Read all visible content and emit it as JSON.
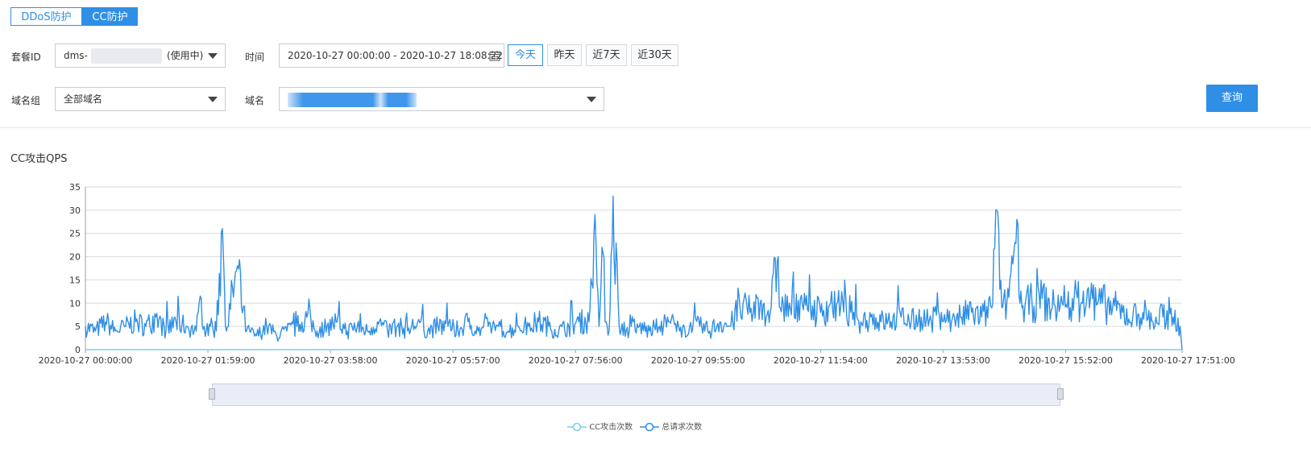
{
  "tabs": [
    {
      "label": "DDoS防护",
      "active": false
    },
    {
      "label": "CC防护",
      "active": true
    }
  ],
  "filters": {
    "package_label": "套餐ID",
    "package_value_prefix": "dms-",
    "package_value_suffix": "(使用中)",
    "time_label": "时间",
    "time_value": "2020-10-27 00:00:00 - 2020-10-27 18:08:22",
    "quick_ranges": [
      "今天",
      "昨天",
      "近7天",
      "近30天"
    ],
    "active_quick_range": "今天",
    "domain_group_label": "域名组",
    "domain_group_value": "全部域名",
    "domain_label": "域名",
    "search_label": "查询"
  },
  "chart_title": "CC攻击QPS",
  "colors": {
    "accent": "#2f8fe6",
    "series_total": "#2f8fe6",
    "series_cc": "#7ecbee",
    "grid": "#d9dce0"
  },
  "chart_data": {
    "type": "line",
    "title": "CC攻击QPS",
    "xlabel": "",
    "ylabel": "",
    "ylim": [
      0,
      35
    ],
    "yticks": [
      0,
      5,
      10,
      15,
      20,
      25,
      30,
      35
    ],
    "x_tick_labels": [
      "2020-10-27 00:00:00",
      "2020-10-27 01:59:00",
      "2020-10-27 03:58:00",
      "2020-10-27 05:57:00",
      "2020-10-27 07:56:00",
      "2020-10-27 09:55:00",
      "2020-10-27 11:54:00",
      "2020-10-27 13:53:00",
      "2020-10-27 15:52:00",
      "2020-10-27 17:51:00"
    ],
    "grid": true,
    "legend_position": "bottom",
    "x_minutes_start": 0,
    "x_minutes_end": 1089,
    "series": [
      {
        "name": "CC攻击次数",
        "style": "flat",
        "x": [
          0,
          1089
        ],
        "y": [
          0,
          0
        ]
      },
      {
        "name": "总请求次数",
        "style": "noisy",
        "x": [
          0,
          10,
          20,
          30,
          40,
          50,
          60,
          70,
          80,
          90,
          100,
          110,
          115,
          118,
          120,
          124,
          130,
          136,
          140,
          150,
          160,
          170,
          180,
          190,
          200,
          210,
          220,
          230,
          240,
          250,
          260,
          270,
          280,
          290,
          300,
          310,
          320,
          330,
          340,
          350,
          360,
          370,
          380,
          390,
          400,
          410,
          420,
          430,
          440,
          450,
          460,
          470,
          480,
          490,
          500,
          505,
          510,
          513,
          517,
          520,
          524,
          530,
          540,
          542,
          544,
          546,
          550,
          560,
          570,
          580,
          590,
          600,
          610,
          620,
          630,
          640,
          650,
          660,
          670,
          680,
          688,
          690,
          700,
          710,
          720,
          730,
          740,
          750,
          760,
          770,
          780,
          790,
          800,
          810,
          820,
          830,
          840,
          850,
          860,
          870,
          880,
          890,
          900,
          905,
          908,
          910,
          915,
          926,
          928,
          930,
          940,
          950,
          960,
          970,
          980,
          990,
          1000,
          1010,
          1020,
          1030,
          1040,
          1050,
          1060,
          1070,
          1080,
          1087,
          1089
        ],
        "y": [
          5,
          4,
          6,
          4,
          5,
          6,
          5,
          7,
          4,
          6,
          5,
          4,
          11,
          5,
          4,
          5,
          4,
          26,
          4,
          17,
          4,
          3,
          5,
          3,
          4,
          5,
          7,
          4,
          5,
          6,
          4,
          5,
          4,
          6,
          4,
          5,
          4,
          6,
          4,
          5,
          5,
          4,
          6,
          4,
          5,
          5,
          4,
          5,
          5,
          6,
          5,
          4,
          5,
          6,
          6,
          25,
          5,
          22,
          6,
          4,
          33,
          5,
          4,
          5,
          6,
          4,
          5,
          4,
          5,
          6,
          4,
          5,
          5,
          4,
          6,
          5,
          9,
          8,
          10,
          8,
          20,
          9,
          9,
          11,
          9,
          8,
          10,
          9,
          8,
          6,
          7,
          6,
          6,
          7,
          6,
          7,
          6,
          8,
          6,
          7,
          8,
          7,
          9,
          30,
          13,
          9,
          10,
          27,
          10,
          9,
          10,
          11,
          9,
          10,
          11,
          10,
          11,
          10,
          9,
          8,
          7,
          8,
          6,
          7,
          7,
          5,
          0
        ]
      }
    ]
  }
}
